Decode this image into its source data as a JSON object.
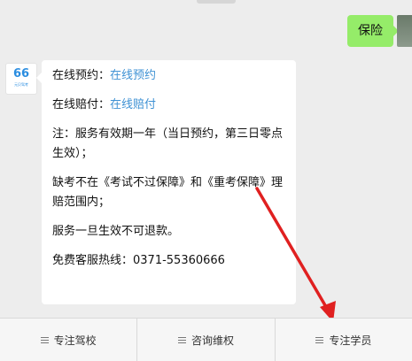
{
  "user_message": {
    "text": "保险"
  },
  "bot_message": {
    "avatar_number": "66",
    "avatar_sub": "元贝驾考",
    "booking_label": "在线预约：",
    "booking_link": "在线预约",
    "claim_label": "在线赔付：",
    "claim_link": "在线赔付",
    "note": "注：服务有效期一年（当日预约，第三日零点生效）；",
    "exclusion": "缺考不在《考试不过保障》和《重考保障》理赔范围内；",
    "refund": "服务一旦生效不可退款。",
    "hotline": "免费客服热线：0371-55360666"
  },
  "menu": {
    "items": [
      {
        "label": "专注驾校"
      },
      {
        "label": "咨询维权"
      },
      {
        "label": "专注学员"
      }
    ]
  },
  "colors": {
    "user_bubble": "#95ec69",
    "link": "#3f92d4",
    "arrow": "#e02020"
  }
}
